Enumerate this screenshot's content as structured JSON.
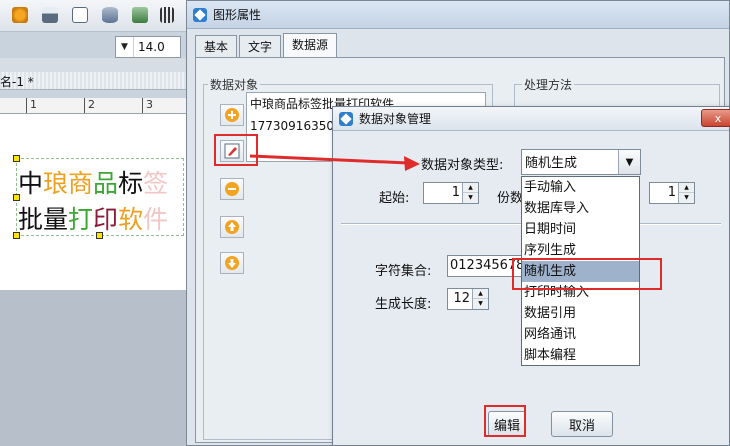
{
  "toolbar": {
    "zoom_value": "14.0",
    "icons": [
      "gear-icon",
      "print-icon",
      "preview-icon",
      "database-icon",
      "db-settings-icon",
      "grid-icon"
    ]
  },
  "document": {
    "tab_label": "名-1 *",
    "ruler_numbers": [
      "1",
      "2",
      "3"
    ],
    "line1": [
      "中",
      "琅",
      "商",
      "品",
      "标",
      "签"
    ],
    "line2": [
      "批",
      "量",
      "打",
      "印",
      "软",
      "件"
    ],
    "line1_colors": [
      "#111111",
      "#f0a020",
      "#f0a020",
      "#3aa832",
      "#111111",
      "#f3c6c6"
    ],
    "line2_colors": [
      "#111111",
      "#111111",
      "#3aa832",
      "#8b1a3a",
      "#f0a020",
      "#f3c6c6"
    ]
  },
  "prop_dialog": {
    "title": "图形属性",
    "tabs": [
      "基本",
      "文字",
      "数据源"
    ],
    "data_object_label": "数据对象",
    "process_label": "处理方法",
    "list_items": [
      "中琅商品标签批量打印软件",
      "17730916350"
    ]
  },
  "manager": {
    "title": "数据对象管理",
    "close_label": "x",
    "type_label": "数据对象类型:",
    "type_value": "随机生成",
    "start_label": "起始:",
    "start_value": "1",
    "copies_label": "份数",
    "copies_value": "1",
    "charset_label": "字符集合:",
    "charset_value": "0123456789",
    "length_label": "生成长度:",
    "length_value": "12",
    "edit_button": "编辑",
    "cancel_button": "取消"
  },
  "dropdown": {
    "options": [
      "手动输入",
      "数据库导入",
      "日期时间",
      "序列生成",
      "随机生成",
      "打印时输入",
      "数据引用",
      "网络通讯",
      "脚本编程"
    ],
    "selected_index": 4
  },
  "colors": {
    "highlight": "#e02b2b",
    "selected_option": "#9fb2cc"
  }
}
